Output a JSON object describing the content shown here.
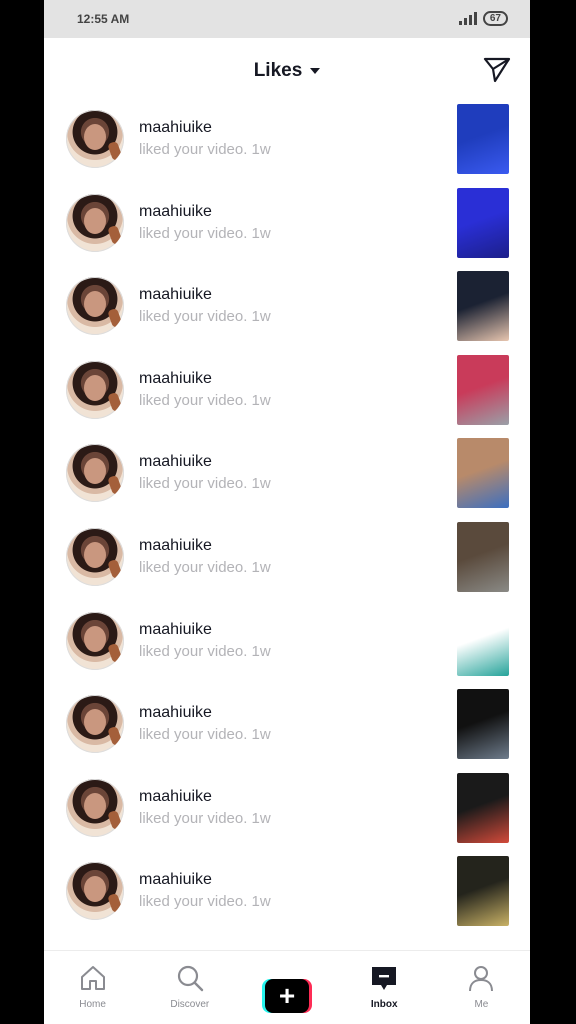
{
  "status_bar": {
    "time": "12:55 AM",
    "battery": "67"
  },
  "header": {
    "title": "Likes"
  },
  "notifications": [
    {
      "user": "maahiuike",
      "text": "liked your video. 1w",
      "thumb_colors": [
        "#1f3dbd",
        "#3a5af0"
      ]
    },
    {
      "user": "maahiuike",
      "text": "liked your video. 1w",
      "thumb_colors": [
        "#2a2fd6",
        "#1c1f8a"
      ]
    },
    {
      "user": "maahiuike",
      "text": "liked your video. 1w",
      "thumb_colors": [
        "#1b2233",
        "#e8c6b0"
      ]
    },
    {
      "user": "maahiuike",
      "text": "liked your video. 1w",
      "thumb_colors": [
        "#c93b5a",
        "#9aa0a8"
      ]
    },
    {
      "user": "maahiuike",
      "text": "liked your video. 1w",
      "thumb_colors": [
        "#b88a6a",
        "#3c6fc0"
      ]
    },
    {
      "user": "maahiuike",
      "text": "liked your video. 1w",
      "thumb_colors": [
        "#5a4a3c",
        "#8a8a86"
      ]
    },
    {
      "user": "maahiuike",
      "text": "liked your video. 1w",
      "thumb_colors": [
        "#ffffff",
        "#25a39a"
      ]
    },
    {
      "user": "maahiuike",
      "text": "liked your video. 1w",
      "thumb_colors": [
        "#111111",
        "#6e7c8c"
      ]
    },
    {
      "user": "maahiuike",
      "text": "liked your video. 1w",
      "thumb_colors": [
        "#1a1a1a",
        "#d34a3a"
      ]
    },
    {
      "user": "maahiuike",
      "text": "liked your video. 1w",
      "thumb_colors": [
        "#24241c",
        "#c9b266"
      ]
    }
  ],
  "bottom_nav": [
    {
      "label": "Home",
      "icon": "home-icon",
      "active": false
    },
    {
      "label": "Discover",
      "icon": "search-icon",
      "active": false
    },
    {
      "label": "",
      "icon": "plus-icon",
      "active": false
    },
    {
      "label": "Inbox",
      "icon": "inbox-icon",
      "active": true
    },
    {
      "label": "Me",
      "icon": "person-icon",
      "active": false
    }
  ]
}
